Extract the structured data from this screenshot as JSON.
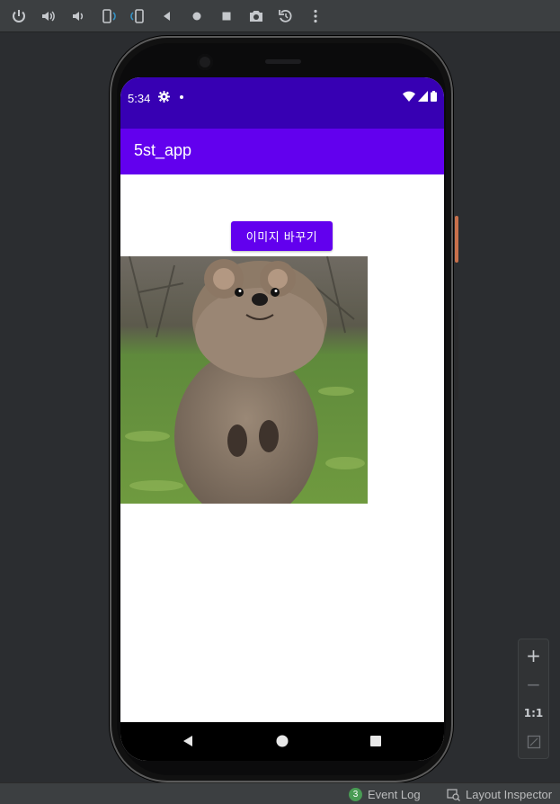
{
  "toolbar": {
    "buttons": [
      "power-icon",
      "volume-up-icon",
      "volume-down-icon",
      "rotate-left-icon",
      "rotate-right-icon",
      "back-icon",
      "home-icon",
      "overview-icon",
      "camera-icon",
      "snapshot-icon",
      "more-icon"
    ]
  },
  "status_bar": {
    "time": "5:34",
    "color": "#3700b3"
  },
  "app_bar": {
    "title": "5st_app",
    "color": "#6200ee"
  },
  "content": {
    "change_image_button": "이미지 바꾸기",
    "image": "quokka-photo"
  },
  "zoom_panel": {
    "plus": "+",
    "minus": "−",
    "one_to_one": "1:1"
  },
  "bottom_bar": {
    "event_log_count": "3",
    "event_log_label": "Event Log",
    "layout_inspector_label": "Layout Inspector"
  }
}
